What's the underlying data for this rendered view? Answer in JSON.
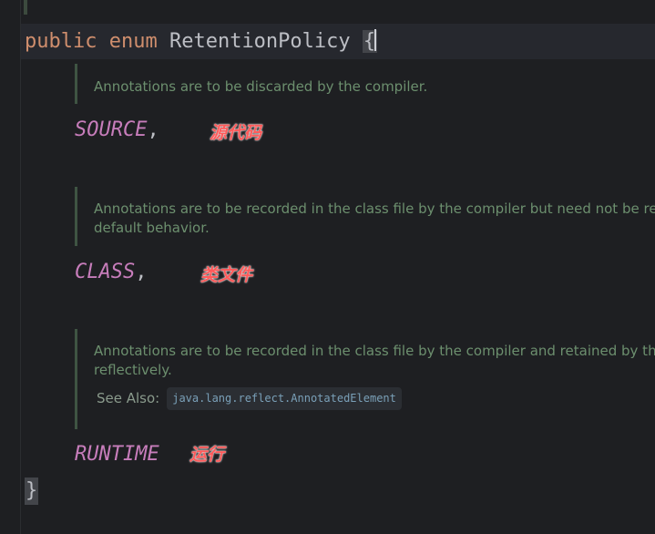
{
  "code": {
    "keyword_public": "public",
    "keyword_enum": "enum",
    "class_name": "RetentionPolicy",
    "open_brace": "{",
    "close_brace": "}"
  },
  "constants": [
    {
      "doc_lines": [
        "Annotations are to be discarded by the compiler."
      ],
      "name": "SOURCE",
      "separator": ",",
      "note": "源代码"
    },
    {
      "doc_lines": [
        "Annotations are to be recorded in the class file by the compiler but need not be retai",
        "default behavior."
      ],
      "name": "CLASS",
      "separator": ",",
      "note": "类文件"
    },
    {
      "doc_lines": [
        "Annotations are to be recorded in the class file by the compiler and retained by the V",
        "reflectively."
      ],
      "see_also_label": "See Also:",
      "see_also_link": "java.lang.reflect.AnnotatedElement",
      "name": "RUNTIME",
      "separator": "",
      "note": "运行"
    }
  ]
}
